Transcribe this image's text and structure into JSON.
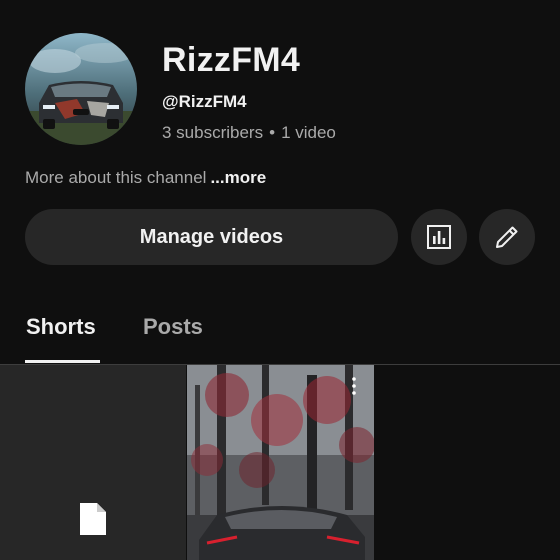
{
  "channel": {
    "name": "RizzFM4",
    "handle": "@RizzFM4",
    "subscribers": "3 subscribers",
    "separator": "•",
    "videos": "1 video"
  },
  "about": {
    "text": "More about this channel",
    "more_label": "...more"
  },
  "actions": {
    "manage_label": "Manage videos",
    "analytics_icon": "analytics-icon",
    "edit_icon": "pencil-icon"
  },
  "tabs": [
    {
      "label": "Shorts",
      "selected": true
    },
    {
      "label": "Posts",
      "selected": false
    }
  ],
  "colors": {
    "background": "#0f0f0f",
    "button": "#272727",
    "secondary_text": "#aaaaaa",
    "primary_text": "#f1f1f1",
    "accent_red": "#b8202c"
  },
  "icons": [
    "file-icon",
    "more-vert-icon"
  ]
}
